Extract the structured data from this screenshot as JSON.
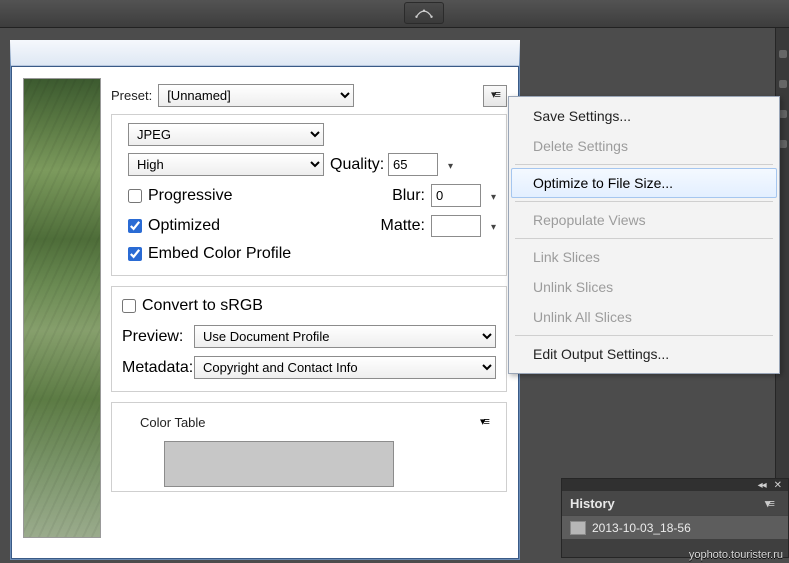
{
  "labels": {
    "preset": "Preset:",
    "quality": "Quality:",
    "progressive": "Progressive",
    "optimized": "Optimized",
    "embed_color_profile": "Embed Color Profile",
    "blur": "Blur:",
    "matte": "Matte:",
    "convert_srgb": "Convert to sRGB",
    "preview": "Preview:",
    "metadata": "Metadata:",
    "color_table": "Color Table"
  },
  "values": {
    "preset": "[Unnamed]",
    "format": "JPEG",
    "quality_preset": "High",
    "quality": "65",
    "blur": "0",
    "preview": "Use Document Profile",
    "metadata": "Copyright and Contact Info"
  },
  "checks": {
    "progressive": false,
    "optimized": true,
    "embed_color_profile": true,
    "convert_srgb": false
  },
  "menu": {
    "save_settings": "Save Settings...",
    "delete_settings": "Delete Settings",
    "optimize_to_file_size": "Optimize to File Size...",
    "repopulate_views": "Repopulate Views",
    "link_slices": "Link Slices",
    "unlink_slices": "Unlink Slices",
    "unlink_all_slices": "Unlink All Slices",
    "edit_output_settings": "Edit Output Settings..."
  },
  "history": {
    "title": "History",
    "item": "2013-10-03_18-56"
  },
  "watermark": "yophoto.tourister.ru"
}
